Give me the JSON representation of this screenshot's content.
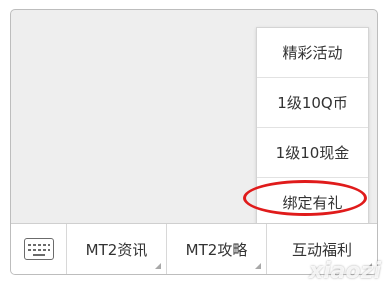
{
  "bottom_bar": {
    "keyboard_icon": "keyboard-icon",
    "menus": [
      {
        "label": "MT2资讯"
      },
      {
        "label": "MT2攻略"
      },
      {
        "label": "互动福利"
      }
    ]
  },
  "popup_menu": {
    "items": [
      {
        "label": "精彩活动"
      },
      {
        "label": "1级10Q币"
      },
      {
        "label": "1级10现金"
      },
      {
        "label": "绑定有礼"
      }
    ]
  },
  "annotation": {
    "highlight_color": "#e01b1b"
  },
  "watermark": {
    "text": "xiaozi"
  }
}
